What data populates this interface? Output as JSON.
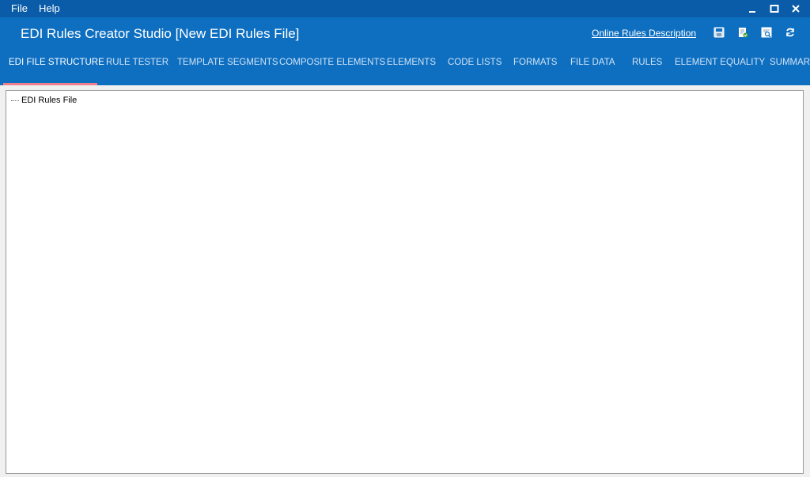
{
  "menu": {
    "items": [
      "File",
      "Help"
    ]
  },
  "window": {
    "minimize": "minimize-icon",
    "maximize": "maximize-icon",
    "close": "close-icon"
  },
  "header": {
    "title": "EDI Rules Creator Studio [New EDI Rules File]",
    "online_link": "Online Rules Description",
    "tools": [
      "save-icon",
      "validate-icon",
      "preview-icon",
      "refresh-icon"
    ]
  },
  "tabs": [
    {
      "label": "EDI FILE STRUCTURE",
      "active": true
    },
    {
      "label": "RULE TESTER"
    },
    {
      "label": "TEMPLATE SEGMENTS"
    },
    {
      "label": "COMPOSITE ELEMENTS"
    },
    {
      "label": "ELEMENTS"
    },
    {
      "label": "CODE LISTS"
    },
    {
      "label": "FORMATS"
    },
    {
      "label": "FILE DATA"
    },
    {
      "label": "RULES"
    },
    {
      "label": "ELEMENT EQUALITY"
    },
    {
      "label": "SUMMARIES"
    }
  ],
  "tree": {
    "root": "EDI Rules File"
  },
  "colors": {
    "menubar": "#0a5ca8",
    "header": "#0e6fc1",
    "active_underline": "#ef7d8b"
  }
}
